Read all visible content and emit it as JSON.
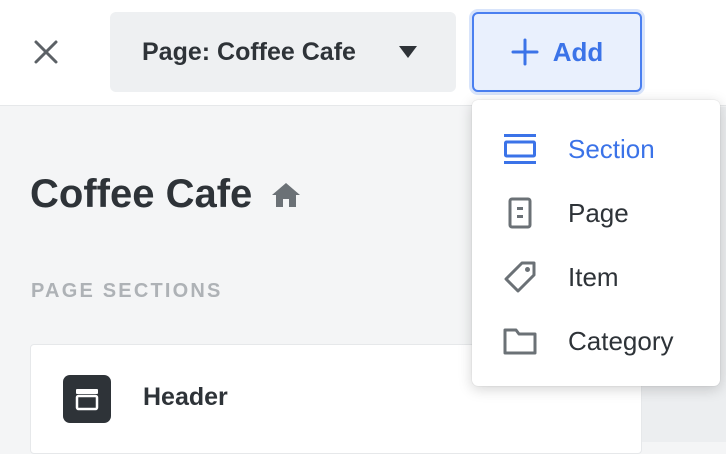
{
  "header": {
    "close_icon": "close-icon",
    "page_select": {
      "label": "Page: Coffee Cafe",
      "icon": "caret-down-icon"
    },
    "add_button": {
      "label": "Add",
      "icon": "plus-icon"
    }
  },
  "main": {
    "page_title": "Coffee Cafe",
    "home_icon": "home-icon",
    "sections_heading": "PAGE SECTIONS",
    "sections": [
      {
        "label": "Header",
        "icon": "header-layout-icon"
      }
    ]
  },
  "add_menu": {
    "items": [
      {
        "label": "Section",
        "icon": "section-icon",
        "active": true
      },
      {
        "label": "Page",
        "icon": "page-icon",
        "active": false
      },
      {
        "label": "Item",
        "icon": "tag-icon",
        "active": false
      },
      {
        "label": "Category",
        "icon": "folder-icon",
        "active": false
      }
    ]
  },
  "colors": {
    "accent": "#3b73e8",
    "text": "#2e3338",
    "muted": "#aeb2b6",
    "icon_gray": "#6b7176"
  }
}
